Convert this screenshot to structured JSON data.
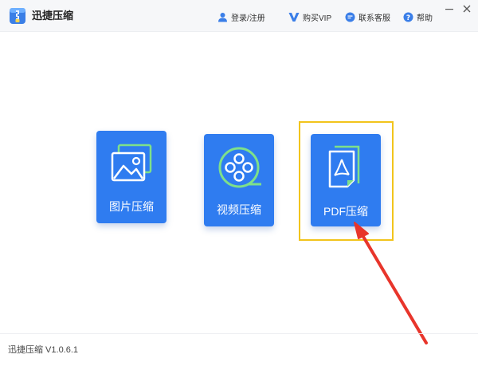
{
  "app": {
    "title": "迅捷压缩",
    "version": "迅捷压缩 V1.0.6.1"
  },
  "nav": {
    "login_label": "登录/注册",
    "vip_label": "购买VIP",
    "service_label": "联系客服",
    "help_label": "帮助"
  },
  "cards": [
    {
      "label": "图片压缩",
      "icon": "image-icon"
    },
    {
      "label": "视频压缩",
      "icon": "film-reel-icon"
    },
    {
      "label": "PDF压缩",
      "icon": "pdf-file-icon"
    }
  ],
  "colors": {
    "card_blue": "#2f7cf0",
    "highlight": "#f2c41c",
    "arrow": "#e8352b",
    "nav_icon": "#3a7ee8",
    "pdf_fold": "#7ee08a"
  }
}
